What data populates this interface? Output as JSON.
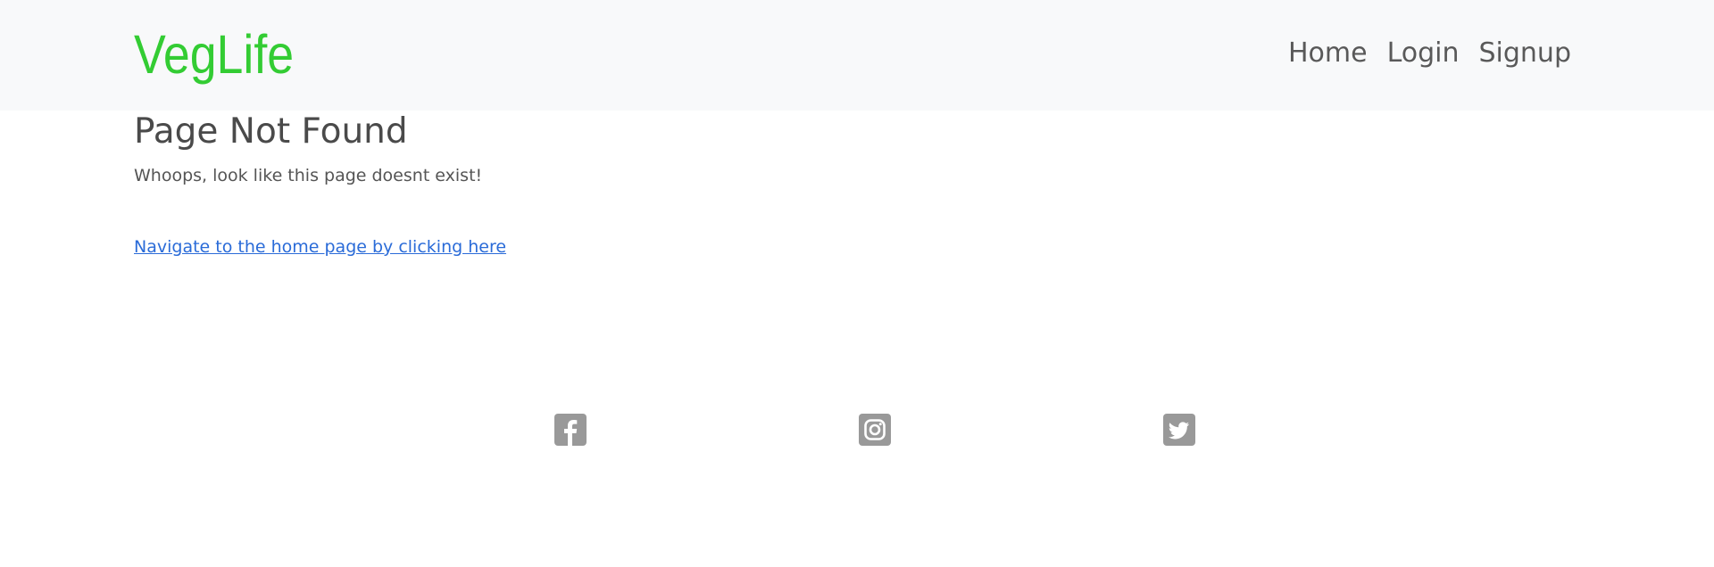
{
  "header": {
    "brand": "VegLife",
    "nav": [
      {
        "label": "Home"
      },
      {
        "label": "Login"
      },
      {
        "label": "Signup"
      }
    ]
  },
  "main": {
    "title": "Page Not Found",
    "message": "Whoops, look like this page doesnt exist!",
    "home_link": "Navigate to the home page by clicking here"
  },
  "footer": {
    "social": [
      {
        "icon": "facebook-square-icon"
      },
      {
        "icon": "instagram-square-icon"
      },
      {
        "icon": "twitter-square-icon"
      }
    ],
    "icon_color": "#999999"
  },
  "colors": {
    "brand": "#33cc33",
    "link": "#2a6bd8",
    "navbar_bg": "#f8f9fa"
  }
}
